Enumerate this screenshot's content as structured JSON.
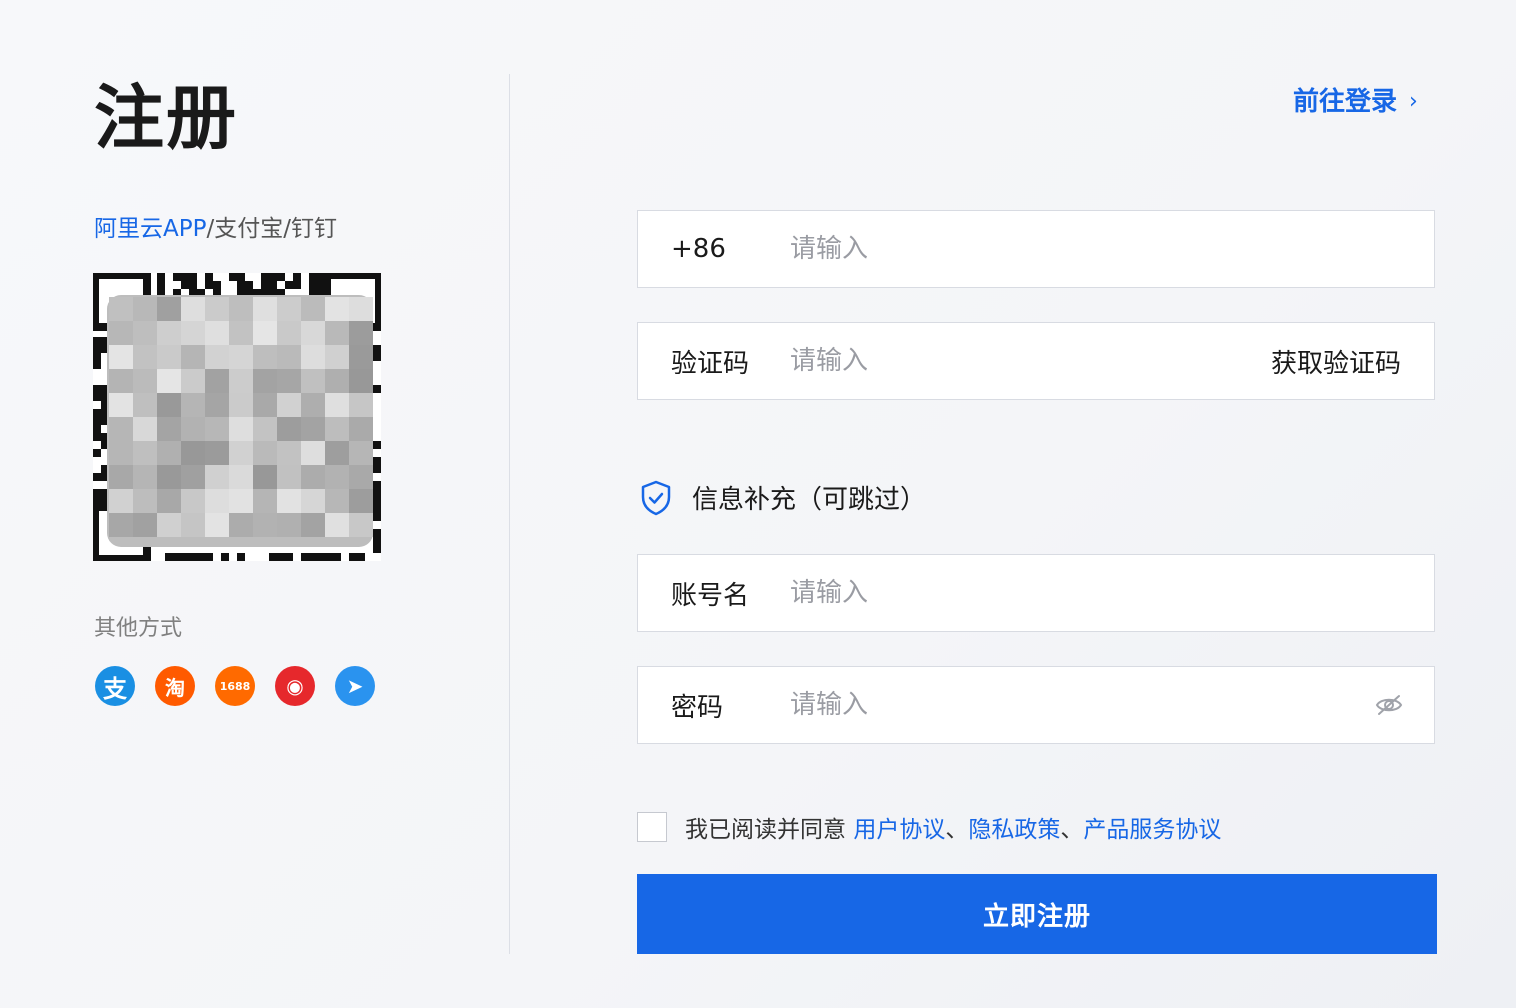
{
  "page": {
    "title": "注册",
    "goto_login": "前往登录",
    "colors": {
      "accent": "#1767e6",
      "button": "#1767e6"
    }
  },
  "qr": {
    "caption_blue": "阿里云APP",
    "caption_rest": "/支付宝/钉钉"
  },
  "other_methods": {
    "label": "其他方式",
    "items": [
      {
        "name": "alipay-icon",
        "glyph": "支"
      },
      {
        "name": "taobao-icon",
        "glyph": "淘"
      },
      {
        "name": "1688-icon",
        "glyph": "1688"
      },
      {
        "name": "weibo-icon",
        "glyph": "◉"
      },
      {
        "name": "dingtalk-icon",
        "glyph": "➤"
      }
    ]
  },
  "form": {
    "phone": {
      "prefix": "+86",
      "placeholder": "请输入"
    },
    "code": {
      "label": "验证码",
      "placeholder": "请输入",
      "action": "获取验证码"
    },
    "section_title": "信息补充（可跳过）",
    "account": {
      "label": "账号名",
      "placeholder": "请输入"
    },
    "password": {
      "label": "密码",
      "placeholder": "请输入"
    },
    "agreement": {
      "prefix": "我已阅读并同意",
      "links": [
        "用户协议",
        "隐私政策",
        "产品服务协议"
      ],
      "separator": "、"
    },
    "submit": "立即注册"
  }
}
